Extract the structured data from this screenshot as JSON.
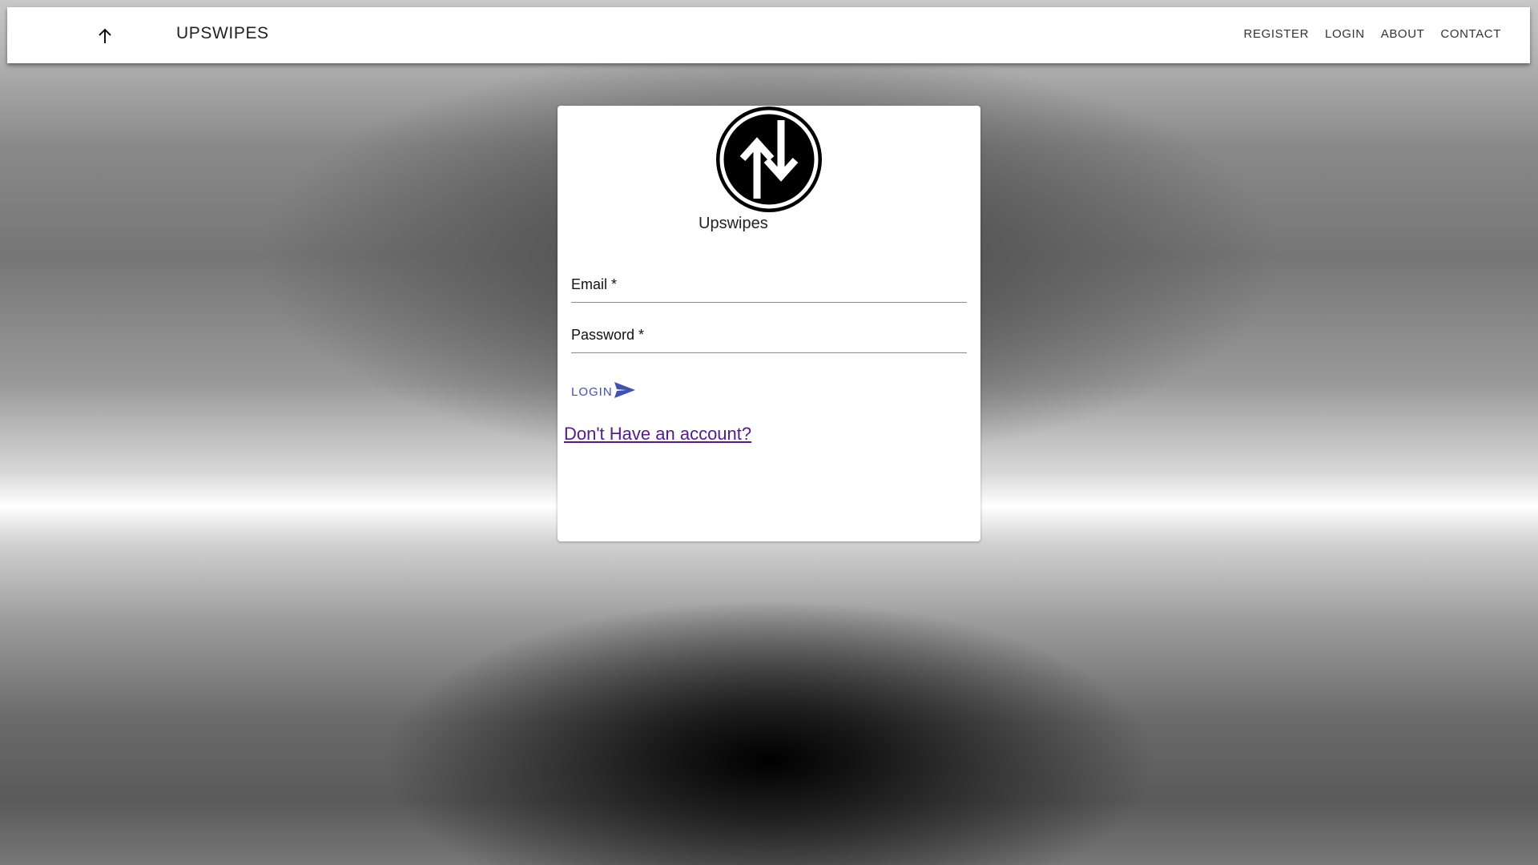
{
  "appbar": {
    "brand": "UPSWIPES",
    "icon": "arrow-up-icon",
    "nav": [
      {
        "label": "REGISTER"
      },
      {
        "label": "LOGIN"
      },
      {
        "label": "ABOUT"
      },
      {
        "label": "CONTACT"
      }
    ]
  },
  "login_card": {
    "logo_icon": "up-down-arrows-circle-icon",
    "logo_caption": "Upswipes",
    "email": {
      "label": "Email *",
      "value": ""
    },
    "password": {
      "label": "Password *",
      "value": ""
    },
    "login_button": {
      "label": "LOGIN",
      "icon": "send-icon"
    },
    "register_link": "Don't Have an account?"
  },
  "colors": {
    "accent": "#3f51b5",
    "visited_link": "#551a8b",
    "appbar_bg": "#ffffff"
  }
}
